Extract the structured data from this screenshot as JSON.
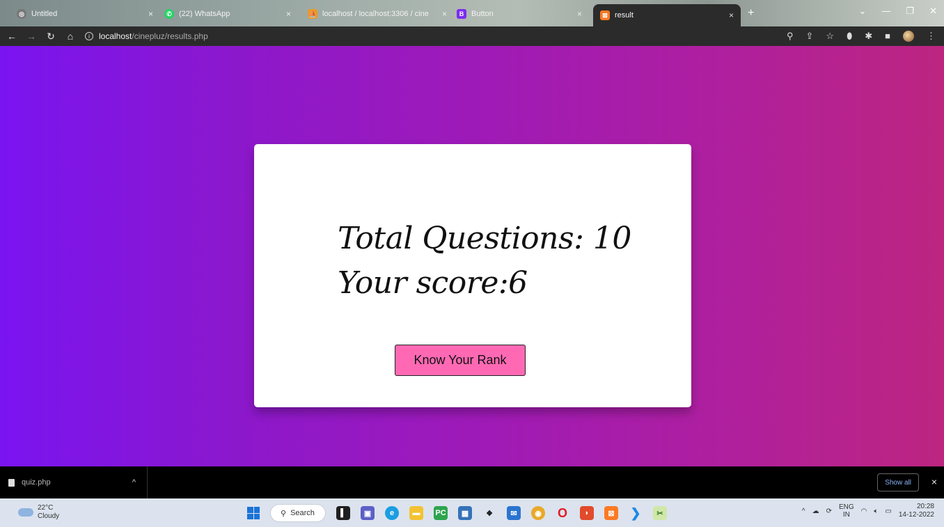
{
  "browser": {
    "tabs": [
      {
        "label": "Untitled",
        "favicon": "globe-icon",
        "close": "×"
      },
      {
        "label": "(22) WhatsApp",
        "favicon": "whatsapp-icon",
        "close": "×"
      },
      {
        "label": "localhost / localhost:3306 / cine",
        "favicon": "phpmyadmin-icon",
        "close": "×"
      },
      {
        "label": "Button",
        "favicon": "bootstrap-icon",
        "close": "×"
      },
      {
        "label": "result",
        "favicon": "xampp-icon",
        "close": "×"
      }
    ],
    "new_tab": "+",
    "address": {
      "host": "localhost",
      "path": "/cinepluz/results.php"
    }
  },
  "results": {
    "total_questions": "Total Questions: 10",
    "your_score": "Your score:6",
    "rank_button": "Know Your Rank"
  },
  "downloads": {
    "file": "quiz.php",
    "show_all": "Show all",
    "close": "×"
  },
  "taskbar": {
    "temperature": "22°C",
    "weather": "Cloudy",
    "search": "Search",
    "lang_top": "ENG",
    "lang_bottom": "IN",
    "time": "20:28",
    "date": "14-12-2022"
  },
  "colors": {
    "gradient_start": "#7a14f0",
    "gradient_end": "#bd2580",
    "rank_button_bg": "#ff69b4"
  }
}
